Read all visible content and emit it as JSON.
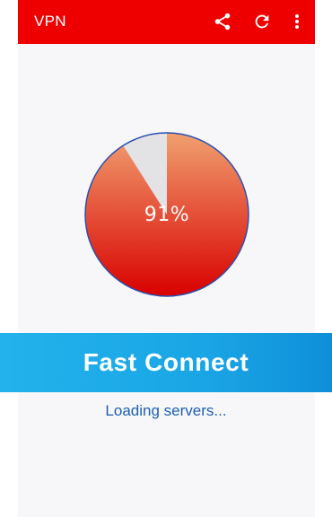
{
  "appbar": {
    "title": "VPN",
    "icons": [
      "share-icon",
      "refresh-icon",
      "more-vert-icon"
    ],
    "background_color": "#ee0000"
  },
  "gauge": {
    "progress": 0.91,
    "label": "91%",
    "fill_color_top": "#f0a070",
    "fill_color_bottom": "#d90000",
    "remaining_color": "#e3e3e6",
    "outline_color": "#2a4fb0"
  },
  "connect": {
    "label": "Fast Connect",
    "color": "#1aa6e6"
  },
  "status": {
    "text": "Loading servers..."
  }
}
